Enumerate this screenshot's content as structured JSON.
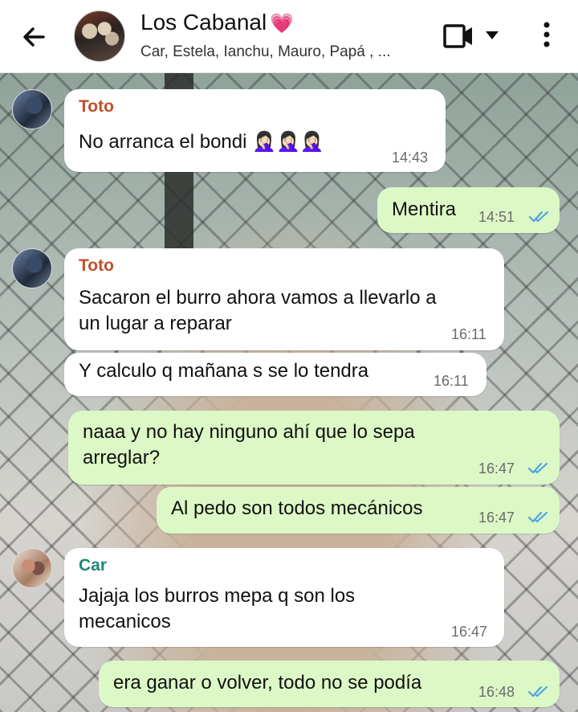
{
  "header": {
    "title": "Los Cabanal",
    "title_emoji": "💗",
    "subtitle": "Car, Estela, Ianchu, Mauro, Papá , ...",
    "icons": [
      "back-arrow-icon",
      "video-call-icon",
      "dropdown-caret-icon",
      "more-options-icon"
    ]
  },
  "messages": [
    {
      "sender": "Toto",
      "text": "No arranca el bondi 🤦🏻‍♀️🤦🏻‍♀️🤦🏻‍♀️",
      "time": "14:43"
    },
    {
      "text": "Mentira",
      "time": "14:51"
    },
    {
      "sender": "Toto",
      "text_line1": "Sacaron el burro ahora vamos a llevarlo a",
      "text_line2": "un lugar a reparar",
      "time": "16:11"
    },
    {
      "text": "Y calculo q mañana s se lo tendra",
      "time": "16:11"
    },
    {
      "text_line1": "naaa y no hay ninguno ahí que lo sepa",
      "text_line2": "arreglar?",
      "time": "16:47"
    },
    {
      "text": "Al pedo son todos mecánicos",
      "time": "16:47"
    },
    {
      "sender": "Car",
      "text_line1": "Jajaja los burros mepa q son los",
      "text_line2": "mecanicos",
      "time": "16:47"
    },
    {
      "text": "era ganar o volver, todo no se podía",
      "time": "16:48"
    }
  ],
  "colors": {
    "sender_toto": "#c0502b",
    "sender_car": "#1f8a7a",
    "incoming_bubble": "#ffffff",
    "outgoing_bubble": "#dcf8c6",
    "read_ticks": "#4fa3e0"
  }
}
